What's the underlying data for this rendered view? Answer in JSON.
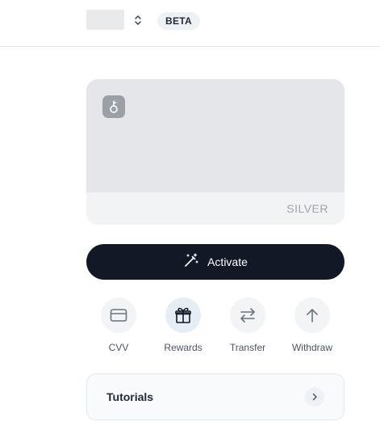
{
  "header": {
    "badge": "BETA",
    "logo_icon": "brand-logo-placeholder",
    "switcher_icon": "chevron-up-down-icon"
  },
  "card": {
    "tier": "SILVER",
    "chip_icon": "key-chip-icon",
    "colors": {
      "top": "#e5e6e9",
      "bottom": "#f2f3f5"
    }
  },
  "activate_button": {
    "label": "Activate",
    "icon": "magic-wand-icon",
    "color": "#121826"
  },
  "actions": [
    {
      "label": "CVV",
      "icon": "credit-card-icon"
    },
    {
      "label": "Rewards",
      "icon": "gift-icon"
    },
    {
      "label": "Transfer",
      "icon": "arrows-left-right-icon"
    },
    {
      "label": "Withdraw",
      "icon": "arrow-up-icon"
    }
  ],
  "tutorials": {
    "label": "Tutorials",
    "icon": "chevron-right-icon"
  }
}
